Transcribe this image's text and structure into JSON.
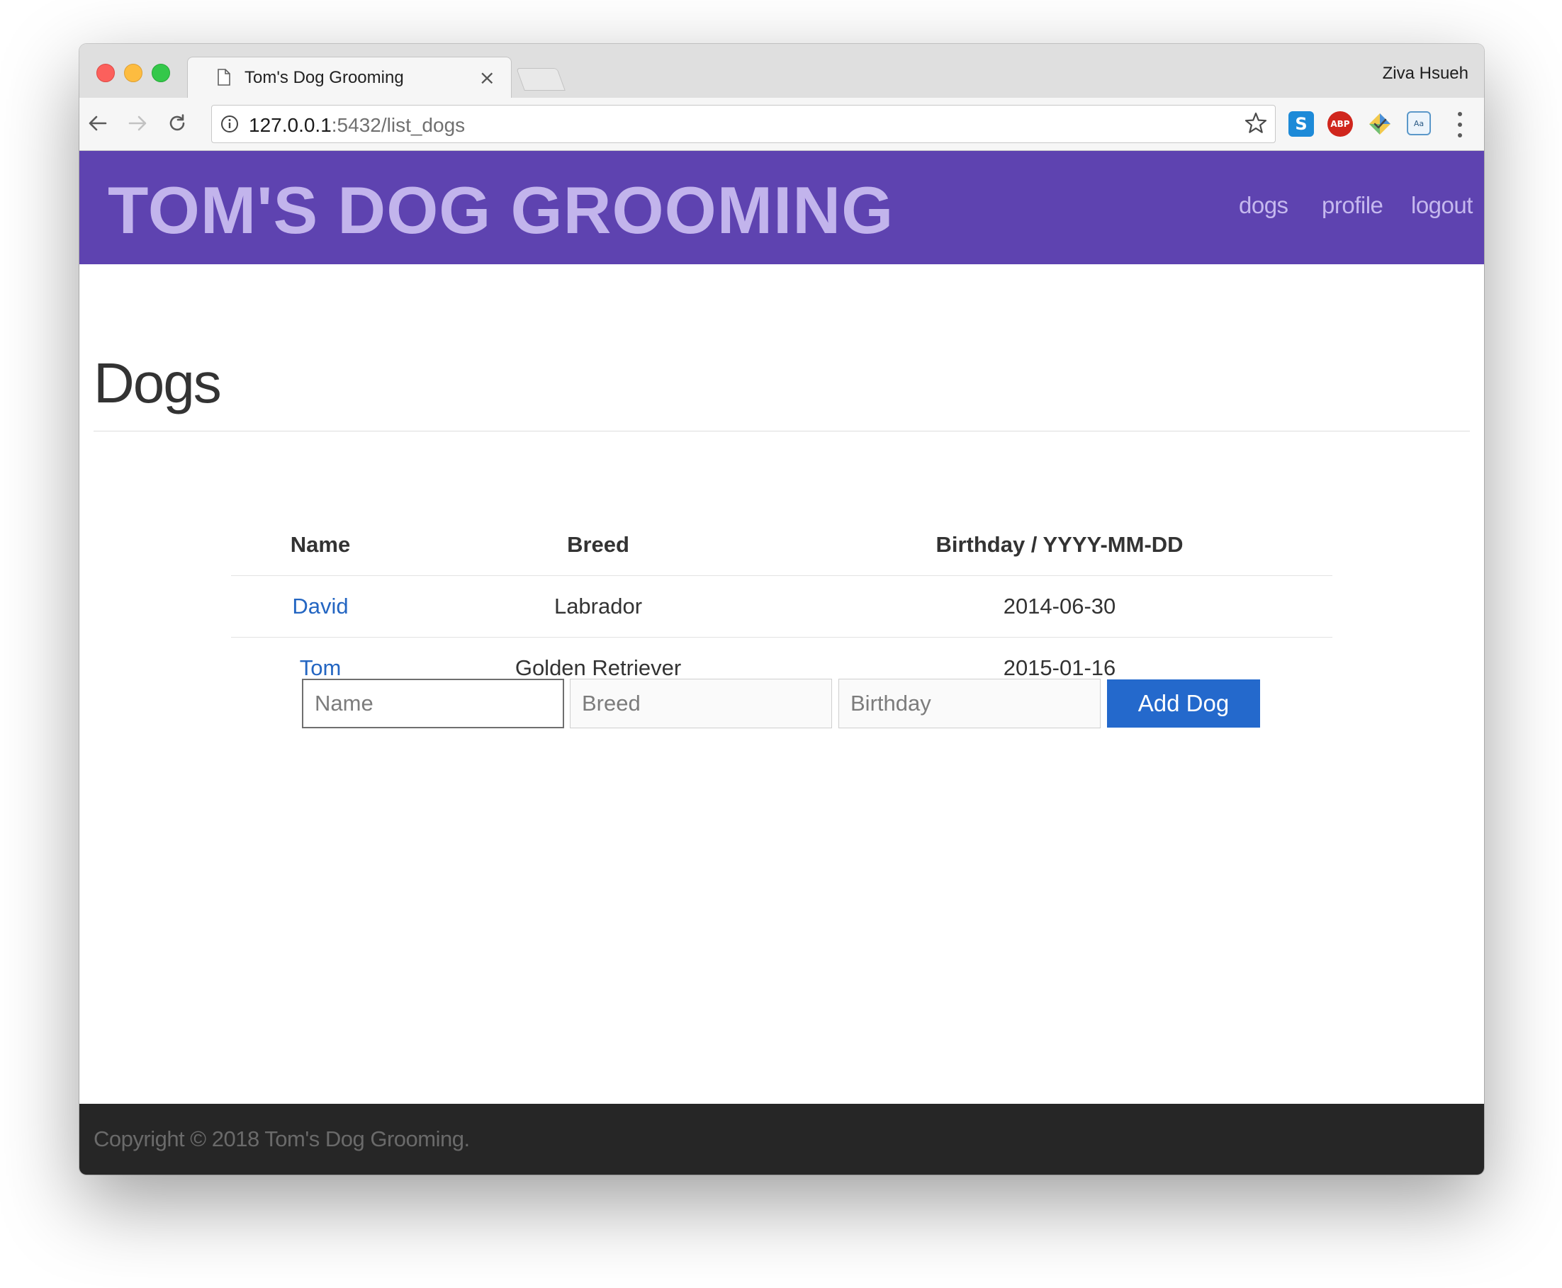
{
  "browser": {
    "tab_title": "Tom's Dog Grooming",
    "tab_close": "×",
    "profile_name": "Ziva Hsueh",
    "url_host": "127.0.0.1",
    "url_path": ":5432/list_dogs",
    "extensions": {
      "s_label": "S",
      "abp_label": "ABP",
      "dict_label": "Aa"
    }
  },
  "header": {
    "brand": "TOM'S DOG GROOMING",
    "nav": {
      "dogs": "dogs",
      "profile": "profile",
      "logout": "logout"
    }
  },
  "main": {
    "title": "Dogs",
    "table": {
      "headers": {
        "name": "Name",
        "breed": "Breed",
        "birthday": "Birthday / YYYY-MM-DD"
      },
      "rows": [
        {
          "name": "David",
          "breed": "Labrador",
          "birthday": "2014-06-30"
        },
        {
          "name": "Tom",
          "breed": "Golden Retriever",
          "birthday": "2015-01-16"
        }
      ]
    },
    "form": {
      "name_placeholder": "Name",
      "breed_placeholder": "Breed",
      "birthday_placeholder": "Birthday",
      "submit_label": "Add Dog"
    }
  },
  "footer": {
    "text": "Copyright © 2018 Tom's Dog Grooming."
  },
  "colors": {
    "header_bg": "#5e43b0",
    "brand_text": "#c2b4ec",
    "link": "#2466c2",
    "button_bg": "#2469cc",
    "footer_bg": "#262626"
  },
  "icons": {
    "back": "arrow-left-icon",
    "forward": "arrow-right-icon",
    "reload": "reload-icon",
    "site_info": "info-icon",
    "bookmark": "star-icon",
    "menu": "vertical-dots-icon",
    "tab_page": "page-icon"
  }
}
